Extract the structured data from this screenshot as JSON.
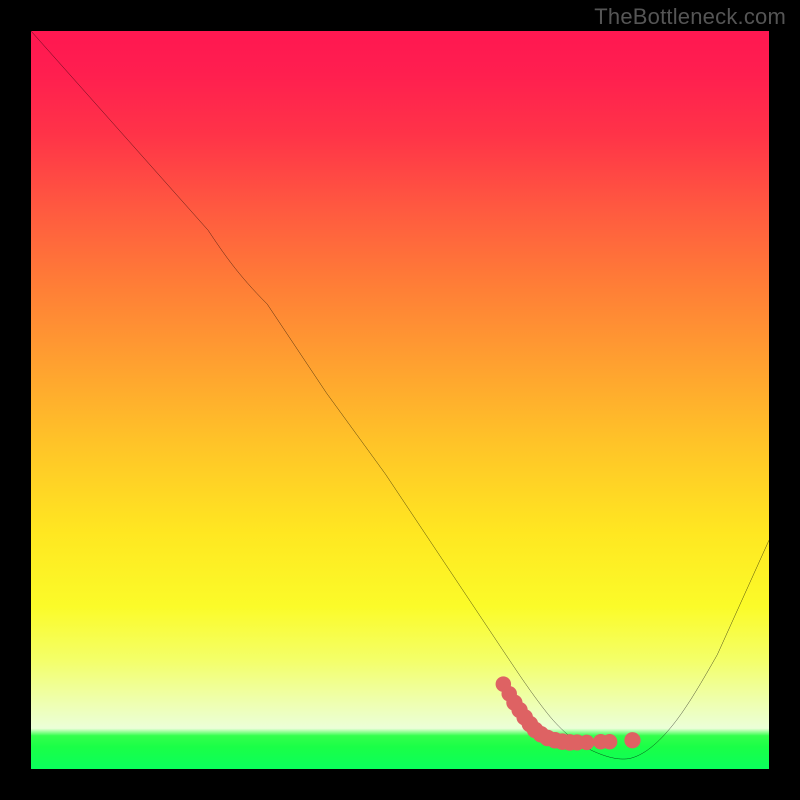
{
  "watermark": "TheBottleneck.com",
  "chart_data": {
    "type": "line",
    "title": "",
    "xlabel": "",
    "ylabel": "",
    "xlim": [
      0,
      100
    ],
    "ylim": [
      0,
      100
    ],
    "series": [
      {
        "name": "curve",
        "x": [
          0,
          8,
          16,
          24,
          32,
          40,
          48,
          56,
          64,
          68,
          72,
          76,
          79,
          82,
          86,
          90,
          94,
          100
        ],
        "y": [
          100,
          91,
          82,
          73,
          63,
          51,
          40,
          28,
          16,
          10,
          5,
          2,
          1,
          1,
          3,
          8,
          17,
          31
        ]
      }
    ],
    "annotations": {
      "dotted_segment": {
        "x": [
          64,
          66,
          68,
          69,
          70,
          71,
          72,
          73,
          74,
          75,
          76,
          77,
          78,
          79,
          81,
          82
        ],
        "y": [
          11.5,
          9,
          7,
          6,
          5,
          4.5,
          4,
          3.8,
          3.7,
          3.6,
          3.5,
          3.5,
          3.6,
          3.6,
          3.8,
          3.8
        ]
      }
    },
    "colors": {
      "curve": "#000000",
      "dots": "#de6263",
      "background_top": "#ff1751",
      "background_bottom": "#0aff5c",
      "frame": "#000000"
    }
  }
}
